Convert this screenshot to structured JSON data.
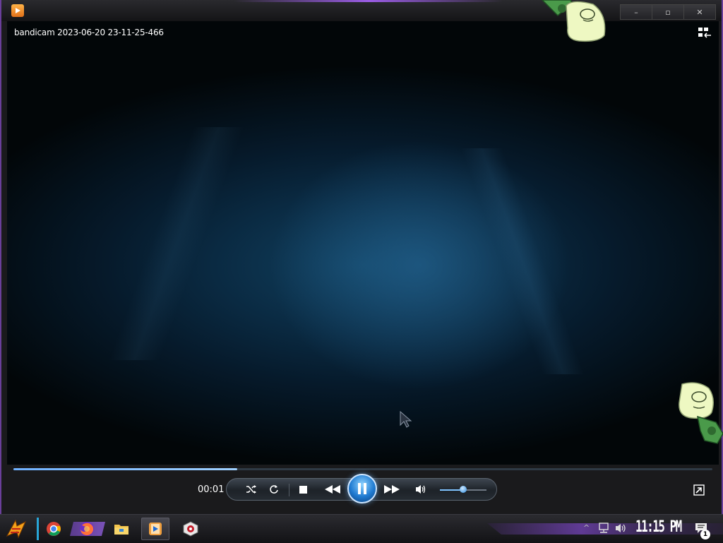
{
  "window": {
    "controls": {
      "minimize": "–",
      "maximize": "▫",
      "close": "✕"
    }
  },
  "video": {
    "watermark": "bandicam 2023-06-20 23-11-25-466"
  },
  "player": {
    "elapsed": "00:01",
    "progress_fraction": 0.32,
    "volume_fraction": 0.5
  },
  "taskbar": {
    "clock": "11:15 PM",
    "notification_count": "1",
    "pinned": [
      "chrome-icon",
      "firefox-icon",
      "file-explorer-icon",
      "media-player-icon",
      "bandicam-icon"
    ]
  },
  "colors": {
    "accent_purple": "#6b3fa8",
    "seek_blue": "#6fb1ff",
    "tray_cyan": "#29a6d8"
  }
}
